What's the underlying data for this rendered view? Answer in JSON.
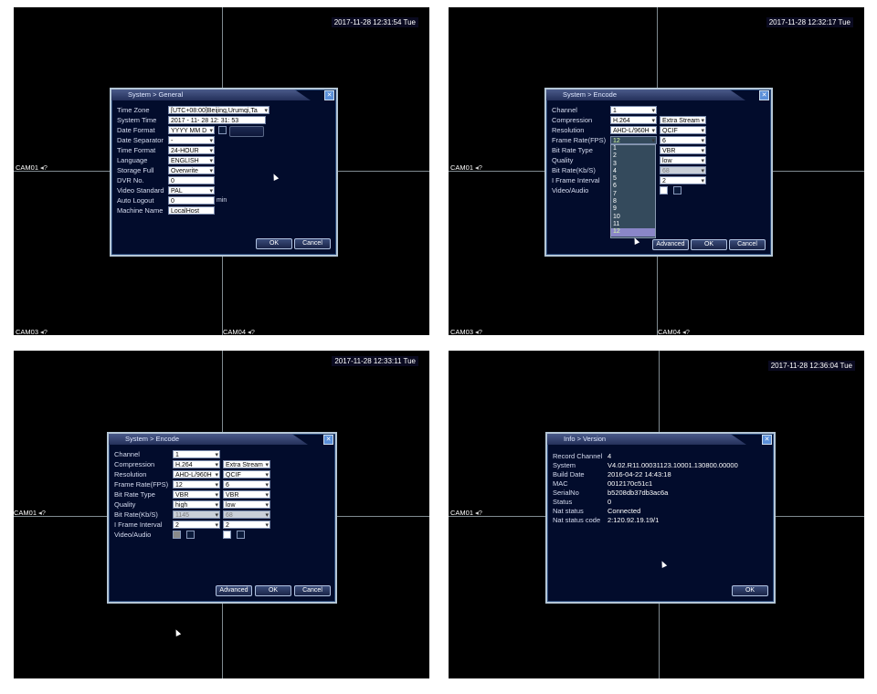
{
  "panel1": {
    "timestamp": "2017-11-28 12:31:54 Tue",
    "cams": {
      "cam01": "CAM01",
      "cam03": "CAM03",
      "cam04": "CAM04"
    },
    "dialog_title": "System > General",
    "fields": [
      {
        "label": "Time Zone",
        "value": "[UTC+08:00]Beijing,Urumqi,Ta"
      },
      {
        "label": "System Time",
        "value": "2017 - 11- 28  12: 31: 53"
      },
      {
        "label": "Date Format",
        "value": "YYYY MM D"
      },
      {
        "label": "Date Separator",
        "value": "-"
      },
      {
        "label": "Time Format",
        "value": "24-HOUR"
      },
      {
        "label": "Language",
        "value": "ENGLISH"
      },
      {
        "label": "Storage Full",
        "value": "Overwrite"
      },
      {
        "label": "DVR No.",
        "value": "0"
      },
      {
        "label": "Video Standard",
        "value": "PAL"
      },
      {
        "label": "Auto Logout",
        "value": "0"
      },
      {
        "label": "Machine Name",
        "value": "LocalHost"
      }
    ],
    "auto_logout_unit": "min",
    "ok": "OK",
    "cancel": "Cancel"
  },
  "panel2": {
    "timestamp": "2017-11-28 12:32:17 Tue",
    "cams": {
      "cam01": "CAM01",
      "cam03": "CAM03",
      "cam04": "CAM04"
    },
    "dialog_title": "System > Encode",
    "labels": [
      "Channel",
      "Compression",
      "Resolution",
      "Frame Rate(FPS)",
      "Bit Rate Type",
      "Quality",
      "Bit Rate(Kb/S)",
      "I Frame Interval",
      "Video/Audio"
    ],
    "main": {
      "channel": "1",
      "compression": "H.264",
      "resolution": "AHD-L/960H",
      "frame_rate": "12"
    },
    "extra": {
      "compression": "Extra Stream",
      "resolution": "QCIF",
      "frame_rate": "6",
      "bitrate_type": "VBR",
      "quality": "low",
      "bitrate": "68",
      "iframe": "2"
    },
    "fps_options": [
      "1",
      "2",
      "3",
      "4",
      "5",
      "6",
      "7",
      "8",
      "9",
      "10",
      "11",
      "12"
    ],
    "fps_selected": "12",
    "advanced": "Advanced",
    "ok": "OK",
    "cancel": "Cancel"
  },
  "panel3": {
    "timestamp": "2017-11-28 12:33:11 Tue",
    "cams": {
      "cam01": "CAM01"
    },
    "dialog_title": "System > Encode",
    "labels": [
      "Channel",
      "Compression",
      "Resolution",
      "Frame Rate(FPS)",
      "Bit Rate Type",
      "Quality",
      "Bit Rate(Kb/S)",
      "I Frame Interval",
      "Video/Audio"
    ],
    "main": {
      "channel": "1",
      "compression": "H.264",
      "resolution": "AHD-L/960H",
      "frame_rate": "12",
      "bitrate_type": "VBR",
      "quality": "high",
      "bitrate": "1145",
      "iframe": "2"
    },
    "extra": {
      "compression": "Extra Stream",
      "resolution": "QCIF",
      "frame_rate": "6",
      "bitrate_type": "VBR",
      "quality": "low",
      "bitrate": "68",
      "iframe": "2"
    },
    "advanced": "Advanced",
    "ok": "OK",
    "cancel": "Cancel"
  },
  "panel4": {
    "timestamp": "2017-11-28 12:36:04 Tue",
    "cams": {
      "cam01": "CAM01"
    },
    "dialog_title": "Info > Version",
    "rows": [
      {
        "label": "Record Channel",
        "value": "4"
      },
      {
        "label": "System",
        "value": "V4.02.R11.00031123.10001.130800.00000"
      },
      {
        "label": "Build Date",
        "value": "2016-04-22 14:43:18"
      },
      {
        "label": "MAC",
        "value": "0012170c51c1"
      },
      {
        "label": "SerialNo",
        "value": "b5208db37db3ac6a"
      },
      {
        "label": "Status",
        "value": "0"
      },
      {
        "label": "Nat status",
        "value": "Connected"
      },
      {
        "label": "Nat status code",
        "value": "2:120.92.19.19/1"
      }
    ],
    "ok": "OK"
  }
}
